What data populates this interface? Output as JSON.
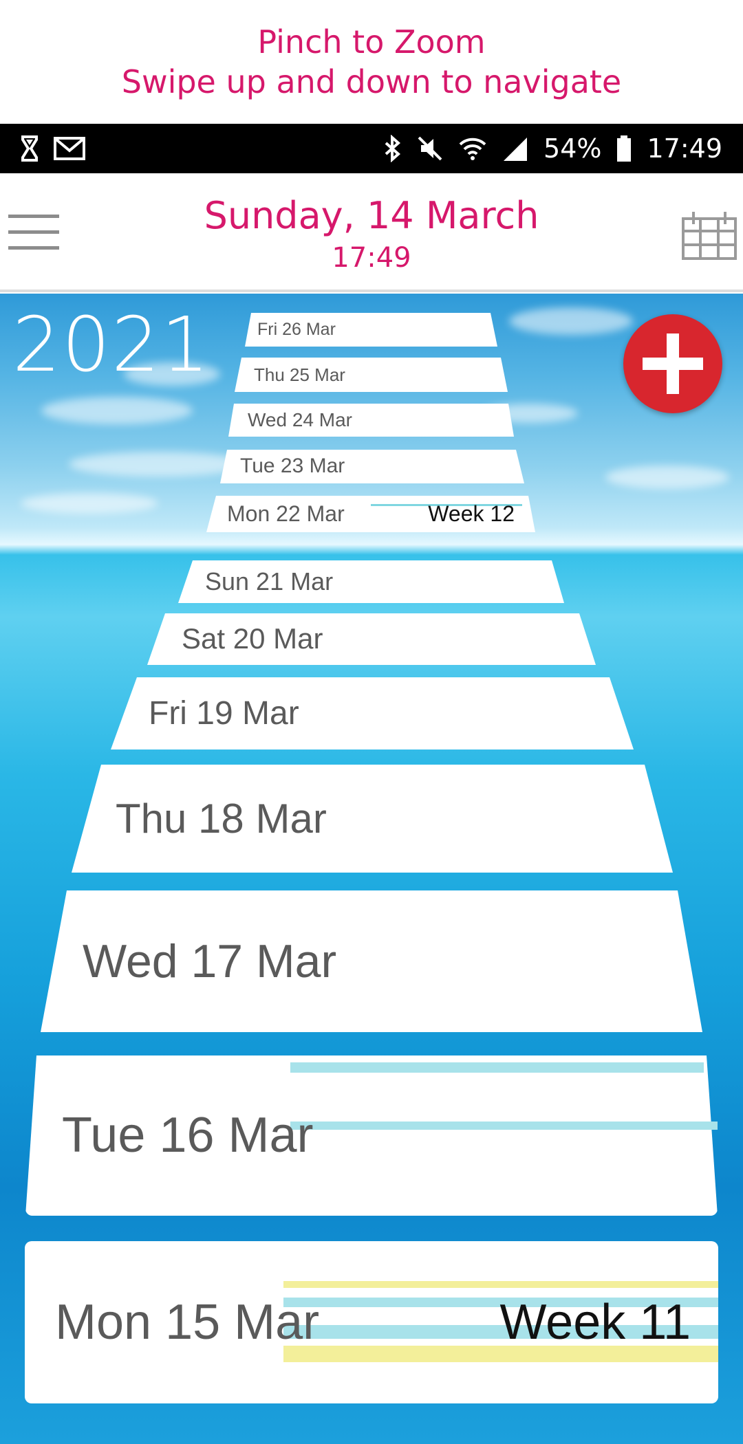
{
  "hint": {
    "line1": "Pinch to Zoom",
    "line2": "Swipe up and down to navigate"
  },
  "status": {
    "battery": "54%",
    "time": "17:49"
  },
  "header": {
    "date": "Sunday, 14 March",
    "time": "17:49"
  },
  "year": "2021",
  "days": [
    {
      "label": "Fri 26 Mar"
    },
    {
      "label": "Thu 25 Mar"
    },
    {
      "label": "Wed 24 Mar"
    },
    {
      "label": "Tue 23 Mar"
    },
    {
      "label": "Mon 22 Mar",
      "week": "Week 12"
    },
    {
      "label": "Sun 21 Mar"
    },
    {
      "label": "Sat 20 Mar"
    },
    {
      "label": "Fri 19 Mar"
    },
    {
      "label": "Thu 18 Mar"
    },
    {
      "label": "Wed 17 Mar"
    },
    {
      "label": "Tue 16 Mar"
    },
    {
      "label": "Mon 15 Mar",
      "week": "Week 11"
    }
  ],
  "colors": {
    "accent": "#d6186b",
    "add": "#d8262e",
    "stripe_blue": "#a8e2ea",
    "stripe_yellow": "#f3ef9a"
  }
}
